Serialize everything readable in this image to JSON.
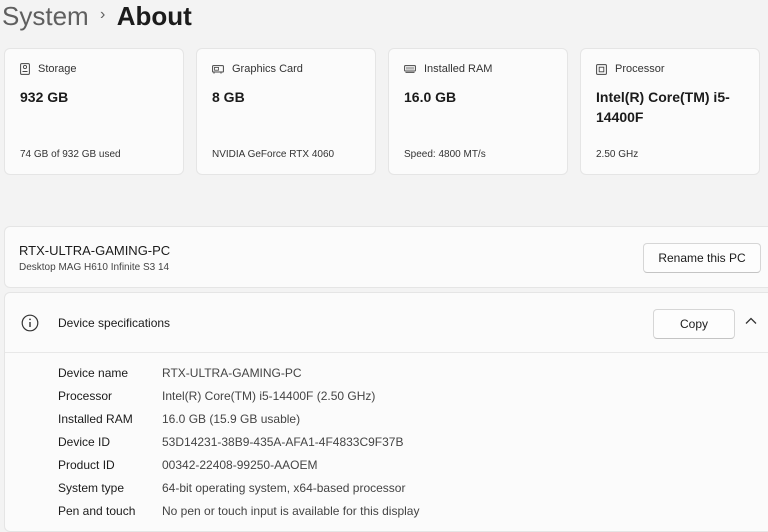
{
  "breadcrumb": {
    "parent": "System",
    "separator": "›",
    "current": "About"
  },
  "cards": [
    {
      "icon": "storage-icon",
      "title": "Storage",
      "value": "932 GB",
      "sub": "74 GB of 932 GB used"
    },
    {
      "icon": "graphics-card-icon",
      "title": "Graphics Card",
      "value": "8 GB",
      "sub": "NVIDIA GeForce RTX 4060"
    },
    {
      "icon": "ram-icon",
      "title": "Installed RAM",
      "value": "16.0 GB",
      "sub": "Speed: 4800 MT/s"
    },
    {
      "icon": "processor-icon",
      "title": "Processor",
      "value": "Intel(R) Core(TM) i5-14400F",
      "sub": "2.50 GHz"
    }
  ],
  "pc": {
    "name": "RTX-ULTRA-GAMING-PC",
    "model": "Desktop MAG H610 Infinite S3 14",
    "rename_label": "Rename this PC"
  },
  "specs": {
    "title": "Device specifications",
    "copy_label": "Copy",
    "rows": [
      {
        "label": "Device name",
        "value": "RTX-ULTRA-GAMING-PC"
      },
      {
        "label": "Processor",
        "value": "Intel(R) Core(TM) i5-14400F (2.50 GHz)"
      },
      {
        "label": "Installed RAM",
        "value": "16.0 GB (15.9 GB usable)"
      },
      {
        "label": "Device ID",
        "value": "53D14231-38B9-435A-AFA1-4F4833C9F37B"
      },
      {
        "label": "Product ID",
        "value": "00342-22408-99250-AAOEM"
      },
      {
        "label": "System type",
        "value": "64-bit operating system, x64-based processor"
      },
      {
        "label": "Pen and touch",
        "value": "No pen or touch input is available for this display"
      }
    ]
  },
  "colors": {
    "background": "#f3f3f3",
    "card": "#fbfbfb",
    "text": "#1b1b1b"
  }
}
